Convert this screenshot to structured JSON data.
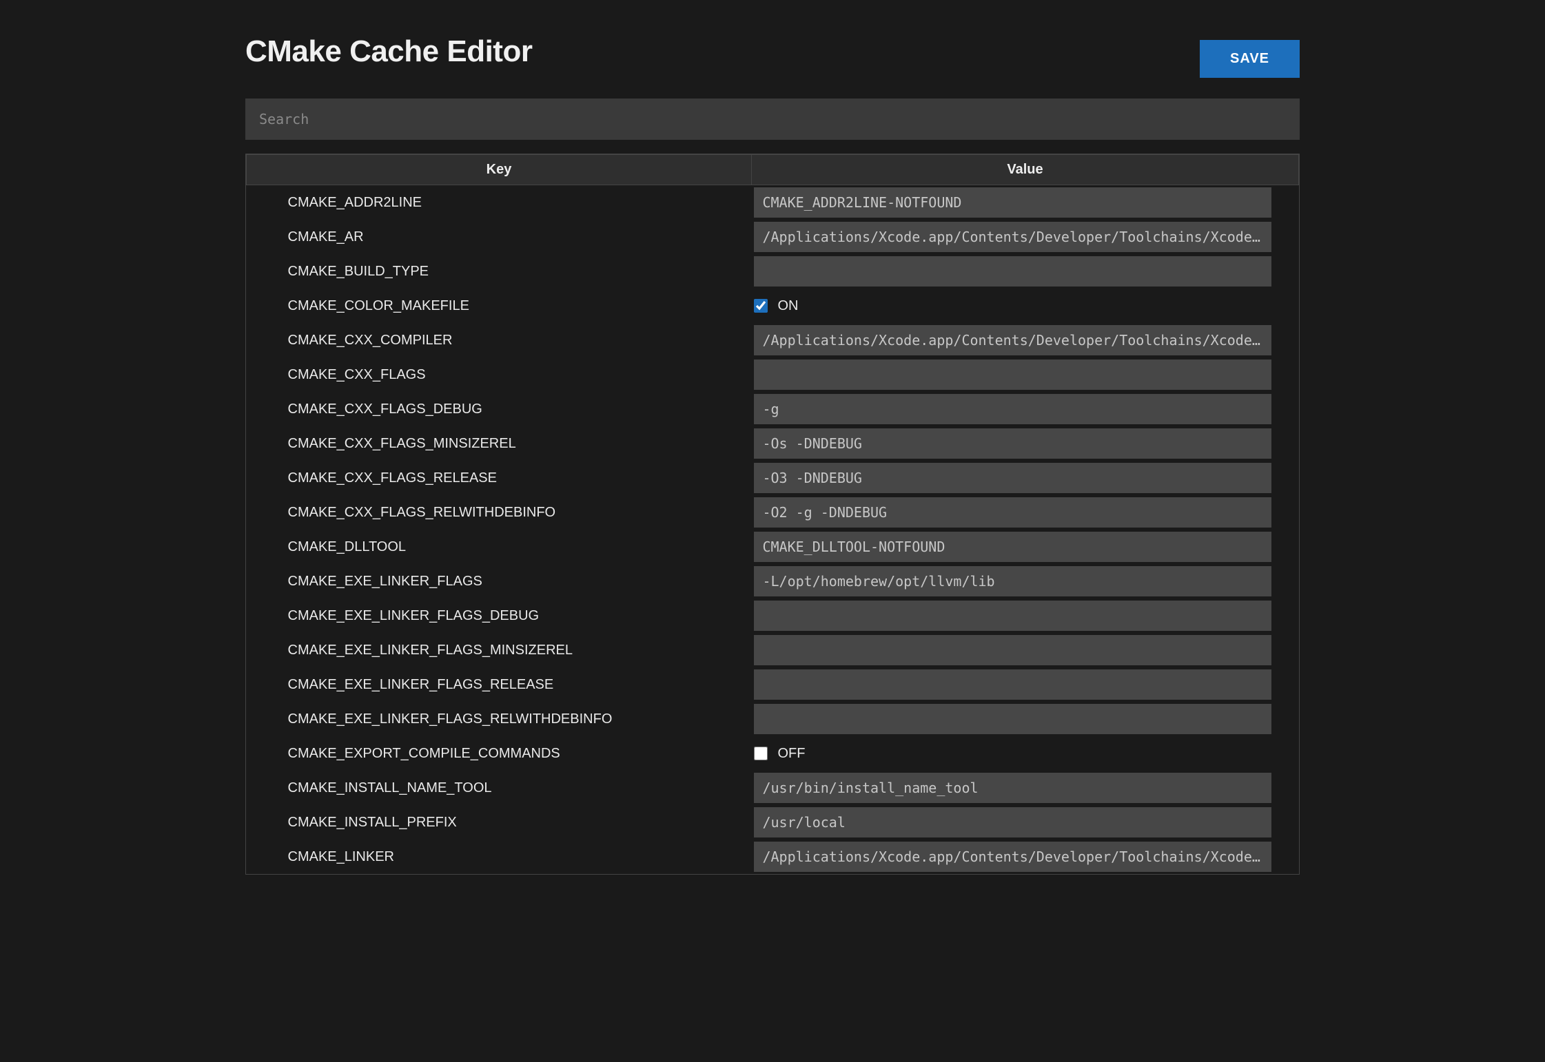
{
  "header": {
    "title": "CMake Cache Editor",
    "save_label": "SAVE"
  },
  "search": {
    "placeholder": "Search",
    "value": ""
  },
  "table": {
    "columns": {
      "key": "Key",
      "value": "Value"
    },
    "labels": {
      "on": "ON",
      "off": "OFF"
    },
    "rows": [
      {
        "key": "CMAKE_ADDR2LINE",
        "type": "text",
        "value": "CMAKE_ADDR2LINE-NOTFOUND"
      },
      {
        "key": "CMAKE_AR",
        "type": "text",
        "value": "/Applications/Xcode.app/Contents/Developer/Toolchains/XcodeDefault.xctoolchain/usr/bin/ar"
      },
      {
        "key": "CMAKE_BUILD_TYPE",
        "type": "text",
        "value": ""
      },
      {
        "key": "CMAKE_COLOR_MAKEFILE",
        "type": "bool",
        "checked": true
      },
      {
        "key": "CMAKE_CXX_COMPILER",
        "type": "text",
        "value": "/Applications/Xcode.app/Contents/Developer/Toolchains/XcodeDefault.xctoolchain/usr/bin/c++"
      },
      {
        "key": "CMAKE_CXX_FLAGS",
        "type": "text",
        "value": ""
      },
      {
        "key": "CMAKE_CXX_FLAGS_DEBUG",
        "type": "text",
        "value": "-g"
      },
      {
        "key": "CMAKE_CXX_FLAGS_MINSIZEREL",
        "type": "text",
        "value": "-Os -DNDEBUG"
      },
      {
        "key": "CMAKE_CXX_FLAGS_RELEASE",
        "type": "text",
        "value": "-O3 -DNDEBUG"
      },
      {
        "key": "CMAKE_CXX_FLAGS_RELWITHDEBINFO",
        "type": "text",
        "value": "-O2 -g -DNDEBUG"
      },
      {
        "key": "CMAKE_DLLTOOL",
        "type": "text",
        "value": "CMAKE_DLLTOOL-NOTFOUND"
      },
      {
        "key": "CMAKE_EXE_LINKER_FLAGS",
        "type": "text",
        "value": "-L/opt/homebrew/opt/llvm/lib"
      },
      {
        "key": "CMAKE_EXE_LINKER_FLAGS_DEBUG",
        "type": "text",
        "value": ""
      },
      {
        "key": "CMAKE_EXE_LINKER_FLAGS_MINSIZEREL",
        "type": "text",
        "value": ""
      },
      {
        "key": "CMAKE_EXE_LINKER_FLAGS_RELEASE",
        "type": "text",
        "value": ""
      },
      {
        "key": "CMAKE_EXE_LINKER_FLAGS_RELWITHDEBINFO",
        "type": "text",
        "value": ""
      },
      {
        "key": "CMAKE_EXPORT_COMPILE_COMMANDS",
        "type": "bool",
        "checked": false
      },
      {
        "key": "CMAKE_INSTALL_NAME_TOOL",
        "type": "text",
        "value": "/usr/bin/install_name_tool"
      },
      {
        "key": "CMAKE_INSTALL_PREFIX",
        "type": "text",
        "value": "/usr/local"
      },
      {
        "key": "CMAKE_LINKER",
        "type": "text",
        "value": "/Applications/Xcode.app/Contents/Developer/Toolchains/XcodeDefault.xctoolchain/usr/bin/ld"
      }
    ]
  }
}
